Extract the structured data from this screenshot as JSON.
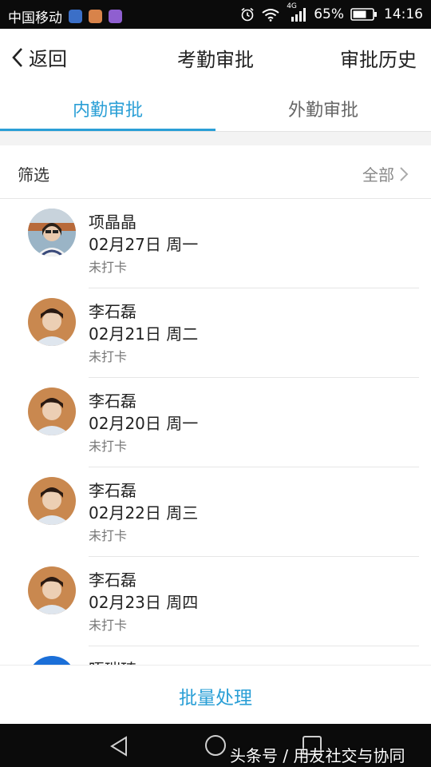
{
  "status_bar": {
    "carrier": "中国移动",
    "network": "4G",
    "battery": "65%",
    "time": "14:16"
  },
  "nav": {
    "back_label": "返回",
    "title": "考勤审批",
    "right_label": "审批历史"
  },
  "tabs": [
    {
      "label": "内勤审批",
      "active": true
    },
    {
      "label": "外勤审批",
      "active": false
    }
  ],
  "filter": {
    "label": "筛选",
    "value": "全部"
  },
  "records": [
    {
      "name": "项晶晶",
      "date": "02月27日 周一",
      "status": "未打卡"
    },
    {
      "name": "李石磊",
      "date": "02月21日 周二",
      "status": "未打卡"
    },
    {
      "name": "李石磊",
      "date": "02月20日 周一",
      "status": "未打卡"
    },
    {
      "name": "李石磊",
      "date": "02月22日 周三",
      "status": "未打卡"
    },
    {
      "name": "李石磊",
      "date": "02月23日 周四",
      "status": "未打卡"
    },
    {
      "name": "晤瑞琦",
      "date": "",
      "status": ""
    }
  ],
  "bottom": {
    "batch_label": "批量处理"
  },
  "watermark": "头条号 / 用友社交与协同",
  "colors": {
    "accent": "#2a9fd6",
    "text": "#222222",
    "muted": "#777777",
    "bar": "#0b0b0b"
  }
}
